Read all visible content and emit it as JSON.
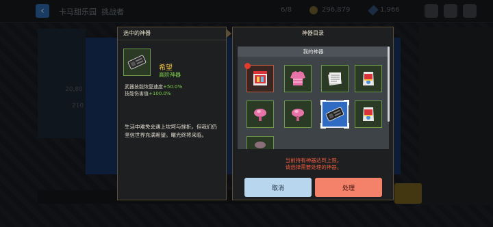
{
  "topbar": {
    "back_icon": "chevron-left-icon",
    "title": "卡马甜乐园",
    "stage": "挑战者",
    "count": "6/8",
    "gold": "296,879",
    "gems": "1,966"
  },
  "background": {
    "side_value_1": "20,80",
    "side_value_2": "210"
  },
  "left_panel": {
    "header": "选中的神器",
    "artifact_name": "希望",
    "artifact_rank": "高阶神器",
    "stats": [
      {
        "label": "武器技能恢复速度",
        "value": "+50.0%"
      },
      {
        "label": "技能伤害值",
        "value": "+100.0%"
      }
    ],
    "description": "生活中难免会遇上坎坷与挫折。但我们仍坚信世界充满希望。曙光终将来临。"
  },
  "right_panel": {
    "header": "神器目录",
    "inventory_title": "我的神器",
    "slots": [
      {
        "icon": "gift-box-icon",
        "rarity": "red",
        "new": true
      },
      {
        "icon": "pink-sweater-icon",
        "rarity": "green"
      },
      {
        "icon": "newspaper-stack-icon",
        "rarity": "green"
      },
      {
        "icon": "chip-bag-icon",
        "rarity": "green"
      },
      {
        "icon": "pink-candy-icon",
        "rarity": "green"
      },
      {
        "icon": "pink-candy-icon",
        "rarity": "green"
      },
      {
        "icon": "dark-device-icon",
        "rarity": "selected"
      },
      {
        "icon": "chip-bag-icon",
        "rarity": "green"
      },
      {
        "icon": "pink-item-icon",
        "rarity": "green"
      }
    ],
    "warning_line1": "当前持有神器达到上限。",
    "warning_line2": "请选择需要处理的神器。",
    "cancel_label": "取消",
    "confirm_label": "处理"
  },
  "colors": {
    "gold_text": "#f2c53d",
    "green_text": "#7fd04b",
    "warning": "#ef5b3d",
    "cancel_button": "#b8d6ee",
    "confirm_button": "#f4826b",
    "selected_slot": "#2f6bc2"
  }
}
